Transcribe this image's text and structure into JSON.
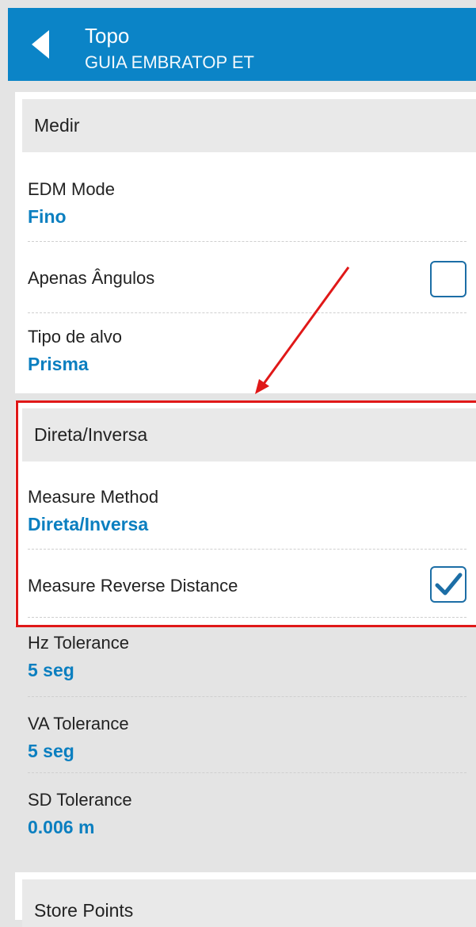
{
  "header": {
    "title": "Topo",
    "subtitle": "GUIA EMBRATOP ET",
    "back_icon": "back-arrow-icon"
  },
  "sections": {
    "medir": {
      "title": "Medir",
      "edm_mode": {
        "label": "EDM Mode",
        "value": "Fino"
      },
      "apenas_angulos": {
        "label": "Apenas Ângulos",
        "checked": false
      },
      "tipo_alvo": {
        "label": "Tipo de alvo",
        "value": "Prisma"
      }
    },
    "direta_inversa": {
      "title": "Direta/Inversa",
      "measure_method": {
        "label": "Measure Method",
        "value": "Direta/Inversa"
      },
      "measure_reverse_distance": {
        "label": "Measure Reverse Distance",
        "checked": true
      },
      "hz_tolerance": {
        "label": "Hz Tolerance",
        "value": "5 seg"
      },
      "va_tolerance": {
        "label": "VA Tolerance",
        "value": "5 seg"
      },
      "sd_tolerance": {
        "label": "SD Tolerance",
        "value": "0.006 m"
      }
    },
    "store_points": {
      "title": "Store Points"
    }
  },
  "colors": {
    "header_bg": "#0b84c7",
    "value_text": "#0b7fc0",
    "annotation": "#e01818"
  }
}
